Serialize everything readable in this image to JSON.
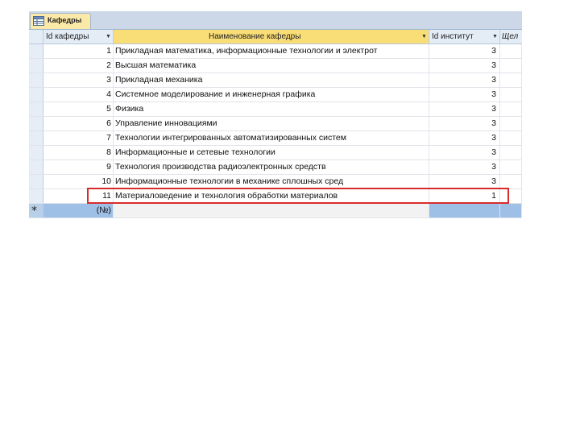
{
  "tab": {
    "label": "Кафедры",
    "icon": "table-icon"
  },
  "columns": {
    "id": "Id кафедры",
    "name": "Наименование кафедры",
    "institute": "Id институт",
    "extra": "Щел"
  },
  "rows": [
    {
      "id": "1",
      "name": "Прикладная математика, информационные технологии и электрот",
      "institute": "3"
    },
    {
      "id": "2",
      "name": "Высшая математика",
      "institute": "3"
    },
    {
      "id": "3",
      "name": "Прикладная механика",
      "institute": "3"
    },
    {
      "id": "4",
      "name": "Системное моделирование и инженерная графика",
      "institute": "3"
    },
    {
      "id": "5",
      "name": "Физика",
      "institute": "3"
    },
    {
      "id": "6",
      "name": "Управление инновациями",
      "institute": "3"
    },
    {
      "id": "7",
      "name": "Технологии интегрированных автоматизированных систем",
      "institute": "3"
    },
    {
      "id": "8",
      "name": "Информационные и сетевые технологии",
      "institute": "3"
    },
    {
      "id": "9",
      "name": "Технология производства радиоэлектронных средств",
      "institute": "3"
    },
    {
      "id": "10",
      "name": "Информационные технологии в механике сплошных сред",
      "institute": "3"
    },
    {
      "id": "11",
      "name": "Материаловедение и технология обработки материалов",
      "institute": "1"
    }
  ],
  "new_row": {
    "marker": "*",
    "id": "(№)"
  },
  "colors": {
    "highlight": "#d92b2b",
    "selected_header": "#f9dd76",
    "new_row": "#9ec0e6"
  }
}
